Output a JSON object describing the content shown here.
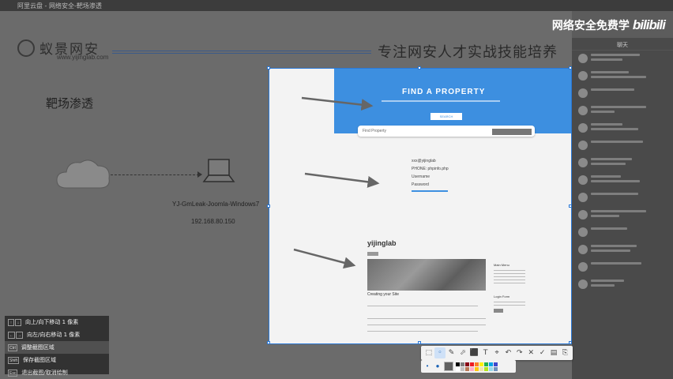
{
  "topbar": {
    "tab_text": "阿里云盘 - 网络安全-靶场渗透",
    "controls": "◂ ▸ ✕"
  },
  "slide": {
    "brand_name": "蚁景网安",
    "brand_url": "www.yijinglab.com",
    "slogan": "专注网安人才实战技能培养",
    "title": "靶场渗透",
    "host_name": "YJ-GmLeak-Joomla-Windows7",
    "host_ip": "192.168.80.150"
  },
  "watermark": {
    "text": "网络安全免费学",
    "logo": "bilibili"
  },
  "chat": {
    "header": "聊天",
    "item_count": 14
  },
  "capture": {
    "hero_title": "FIND A PROPERTY",
    "hero_button": "SEARCH",
    "search_label": "Find Property",
    "mid_rows": [
      "xxx@yijinglab",
      "PHONE: phpinfo.php",
      "Username",
      "Password"
    ],
    "blog_name": "yijinglab",
    "blog_caption": "Creating your Site",
    "side_title_1": "Main Menu",
    "side_title_2": "Login Form"
  },
  "toolbar": {
    "tools": [
      "⬚",
      "◦",
      "✎",
      "⬀",
      "⬛",
      "T",
      "⌖",
      "↶",
      "↷",
      "✕",
      "✓",
      "▤",
      "⎘"
    ],
    "active_tool": 1
  },
  "toolbar2": {
    "sizes": [
      "•",
      "●"
    ],
    "colors": [
      "#000000",
      "#7f7f7f",
      "#880015",
      "#ed1c24",
      "#ff7f27",
      "#fff200",
      "#22b14c",
      "#00a2e8",
      "#3f48cc",
      "#ffffff",
      "#c3c3c3",
      "#b97a57",
      "#ffaec9",
      "#ffc90e",
      "#efe4b0",
      "#b5e61d",
      "#99d9ea",
      "#7092be"
    ],
    "current_color": "#606060"
  },
  "hints": [
    {
      "keys": [
        "↑",
        "↓"
      ],
      "text": "向上/向下移动 1 像素"
    },
    {
      "keys": [
        "←",
        "→"
      ],
      "text": "向左/向右移动 1 像素"
    },
    {
      "keys": [
        "Ctrl"
      ],
      "text": "调整截图区域"
    },
    {
      "keys": [
        "Shift"
      ],
      "text": "保存截图区域"
    },
    {
      "keys": [
        "Esc"
      ],
      "text": "退出截图/取消绘制"
    }
  ]
}
